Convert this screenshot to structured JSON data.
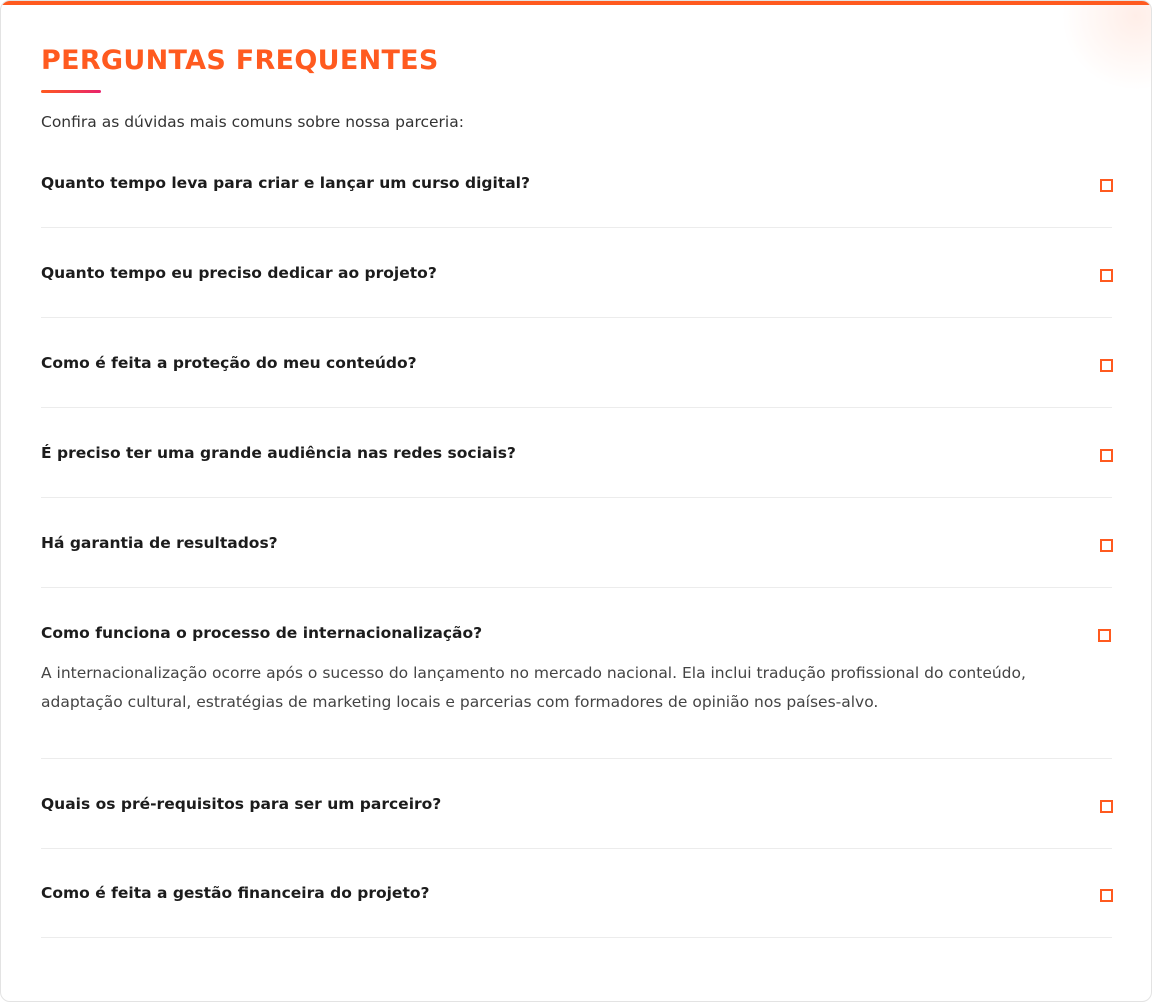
{
  "header": {
    "title": "PERGUNTAS FREQUENTES",
    "subtitle": "Confira as dúvidas mais comuns sobre nossa parceria:"
  },
  "faq": [
    {
      "question": "Quanto tempo leva para criar e lançar um curso digital?",
      "expanded": false
    },
    {
      "question": "Quanto tempo eu preciso dedicar ao projeto?",
      "expanded": false
    },
    {
      "question": "Como é feita a proteção do meu conteúdo?",
      "expanded": false
    },
    {
      "question": "É preciso ter uma grande audiência nas redes sociais?",
      "expanded": false
    },
    {
      "question": "Há garantia de resultados?",
      "expanded": false
    },
    {
      "question": "Como funciona o processo de internacionalização?",
      "expanded": true,
      "answer": "A internacionalização ocorre após o sucesso do lançamento no mercado nacional. Ela inclui tradução profissional do conteúdo, adaptação cultural, estratégias de marketing locais e parcerias com formadores de opinião nos países-alvo."
    },
    {
      "question": "Quais os pré-requisitos para ser um parceiro?",
      "expanded": false
    },
    {
      "question": "Como é feita a gestão financeira do projeto?",
      "expanded": false
    }
  ],
  "icons": {
    "toggle": "square-toggle-icon"
  },
  "colors": {
    "accent": "#ff5a1f",
    "accent_gradient_end": "#e8236c",
    "text": "#1c1c1c",
    "muted_text": "#444444",
    "divider": "#ececec"
  }
}
